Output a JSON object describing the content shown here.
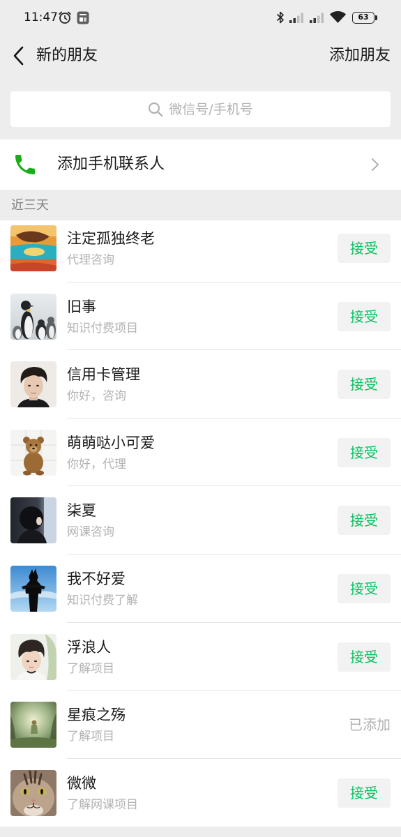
{
  "status_bar": {
    "time": "11:47",
    "battery_level": "63",
    "left_icons": [
      "alarm-clock-icon",
      "notification-icon"
    ],
    "right_icons": [
      "bluetooth-icon",
      "signal-icon",
      "signal-icon",
      "wifi-icon",
      "battery-icon"
    ]
  },
  "header": {
    "back_icon": "chevron-left-icon",
    "title": "新的朋友",
    "action_label": "添加朋友"
  },
  "search": {
    "icon": "search-icon",
    "placeholder": "微信号/手机号"
  },
  "add_phone_contacts": {
    "icon": "phone-icon",
    "label": "添加手机联系人",
    "chevron_icon": "chevron-right-icon"
  },
  "section": {
    "title": "近三天"
  },
  "requests": [
    {
      "name": "注定孤独终老",
      "message": "代理咨询",
      "action_label": "接受",
      "added": false
    },
    {
      "name": "旧事",
      "message": "知识付费项目",
      "action_label": "接受",
      "added": false
    },
    {
      "name": "信用卡管理",
      "message": "你好，咨询",
      "action_label": "接受",
      "added": false
    },
    {
      "name": "萌萌哒小可爱",
      "message": "你好，代理",
      "action_label": "接受",
      "added": false
    },
    {
      "name": "柒夏",
      "message": "网课咨询",
      "action_label": "接受",
      "added": false
    },
    {
      "name": "我不好爱",
      "message": "知识付费了解",
      "action_label": "接受",
      "added": false
    },
    {
      "name": "浮浪人",
      "message": "了解项目",
      "action_label": "接受",
      "added": false
    },
    {
      "name": "星痕之殇",
      "message": "了解项目",
      "action_label": "已添加",
      "added": true
    },
    {
      "name": "微微",
      "message": "了解网课项目",
      "action_label": "接受",
      "added": false
    }
  ],
  "colors": {
    "page_background": "#ededed",
    "surface": "#ffffff",
    "accent_green": "#07c160",
    "phone_icon_green": "#1aad19",
    "button_background": "#f2f2f2",
    "primary_text": "#191919",
    "secondary_text": "#b2b2b2",
    "section_text": "#808080",
    "divider": "#e5e5e5"
  }
}
